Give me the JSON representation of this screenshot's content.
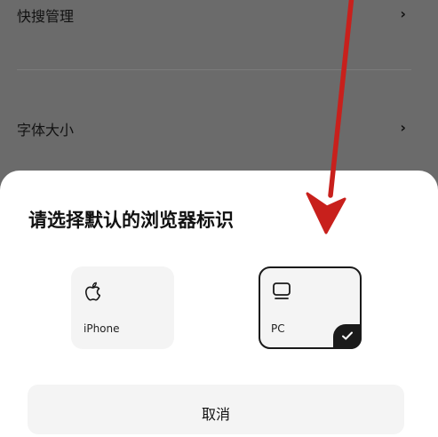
{
  "settings": {
    "items": [
      {
        "label": "快搜管理",
        "chevron": "›"
      },
      {
        "label": "字体大小",
        "chevron": "›"
      }
    ]
  },
  "sheet": {
    "title": "请选择默认的浏览器标识",
    "options": [
      {
        "label": "iPhone",
        "icon": "apple-icon",
        "selected": false
      },
      {
        "label": "PC",
        "icon": "monitor-icon",
        "selected": true
      }
    ],
    "cancel_label": "取消"
  },
  "annotation": {
    "color": "#c8201c"
  }
}
